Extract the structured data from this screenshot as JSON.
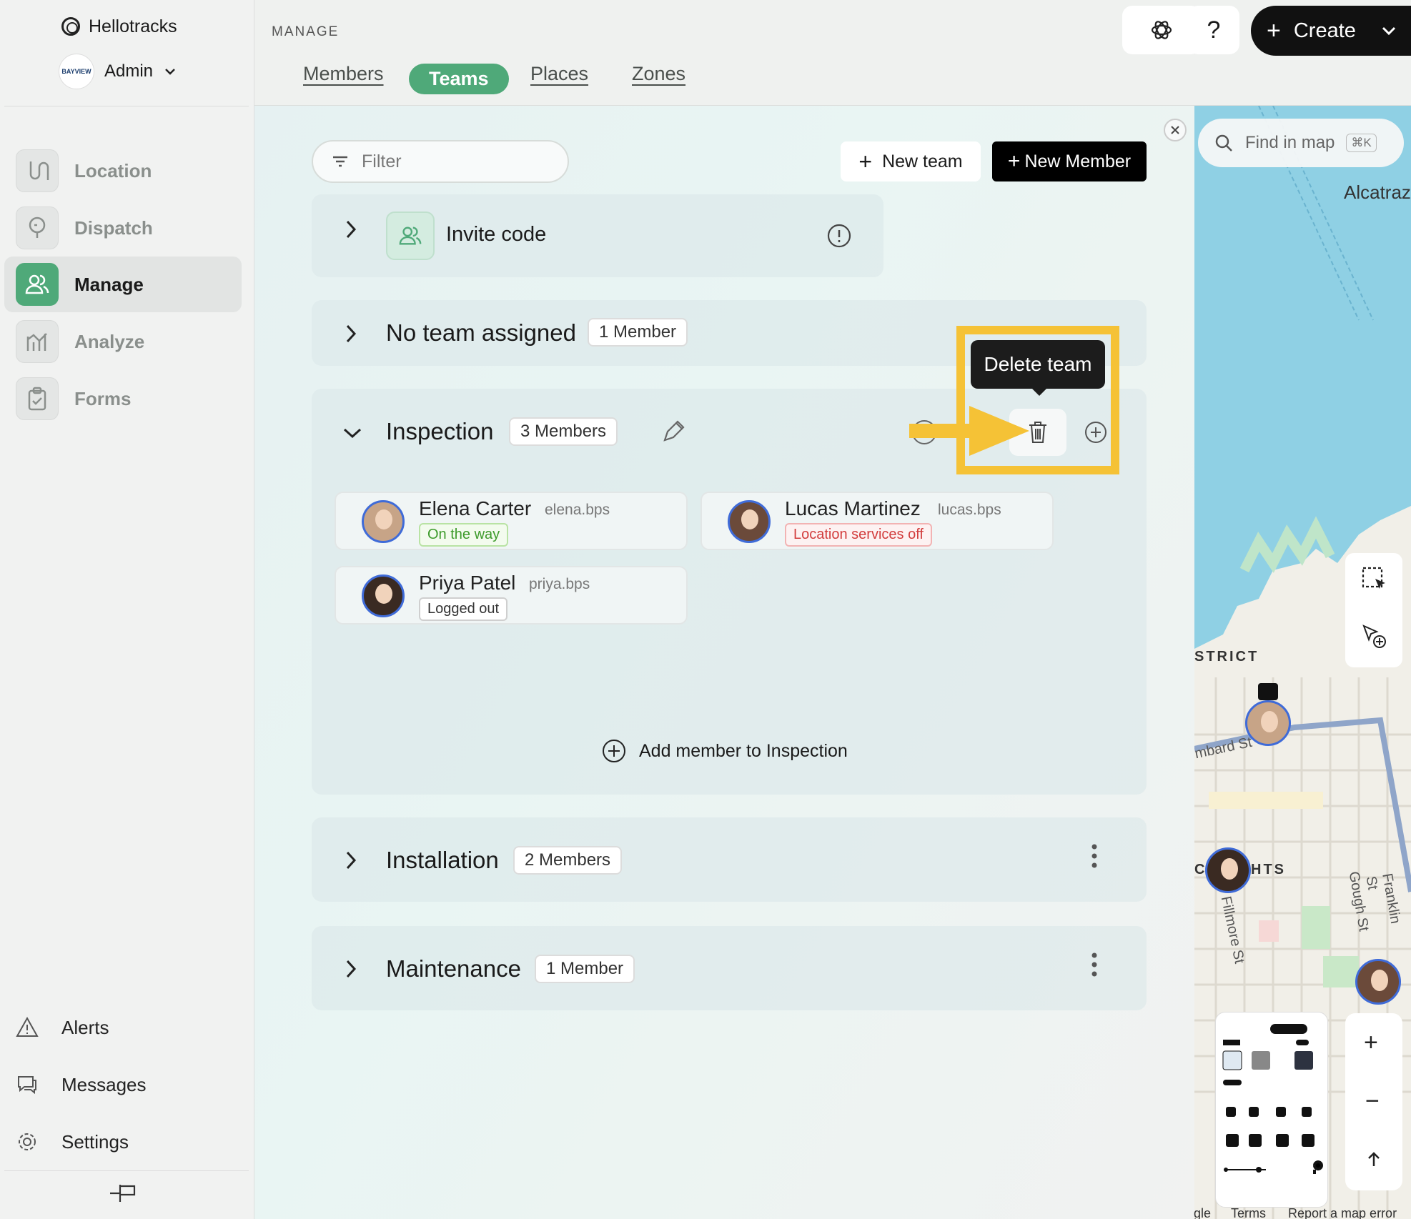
{
  "sidebar": {
    "brand": "Hellotracks",
    "account": {
      "name": "Admin",
      "avatar_text": "BAYVIEW"
    },
    "nav": [
      {
        "label": "Location",
        "icon": "route-icon"
      },
      {
        "label": "Dispatch",
        "icon": "dispatch-icon"
      },
      {
        "label": "Manage",
        "icon": "users-icon",
        "active": true
      },
      {
        "label": "Analyze",
        "icon": "chart-icon"
      },
      {
        "label": "Forms",
        "icon": "clipboard-icon"
      }
    ],
    "bottom": [
      {
        "label": "Alerts",
        "icon": "warning-icon"
      },
      {
        "label": "Messages",
        "icon": "chat-icon"
      },
      {
        "label": "Settings",
        "icon": "gear-icon"
      }
    ],
    "collapse_icon": "pin-collapse-icon"
  },
  "header": {
    "section_label": "MANAGE",
    "tabs": [
      "Members",
      "Teams",
      "Places",
      "Zones"
    ],
    "active_tab": "Teams",
    "help_label": "?",
    "create_label": "Create"
  },
  "toolbar": {
    "filter_placeholder": "Filter",
    "new_team_label": "New team",
    "new_member_label": "New Member"
  },
  "invite": {
    "label": "Invite code"
  },
  "teams": [
    {
      "name": "No team assigned",
      "count": "1 Member"
    },
    {
      "name": "Inspection",
      "count": "3 Members",
      "expanded": true,
      "members": [
        {
          "name": "Elena Carter",
          "username": "elena.bps",
          "status": "On the way",
          "status_color": "#3c9a2a"
        },
        {
          "name": "Lucas Martinez",
          "username": "lucas.bps",
          "status": "Location services off",
          "status_color": "#d23c3c"
        },
        {
          "name": "Priya Patel",
          "username": "priya.bps",
          "status": "Logged out",
          "status_color": "#333333"
        }
      ],
      "add_member_label": "Add member to Inspection"
    },
    {
      "name": "Installation",
      "count": "2 Members"
    },
    {
      "name": "Maintenance",
      "count": "1 Member"
    }
  ],
  "tooltip": {
    "label": "Delete team"
  },
  "map": {
    "search_placeholder": "Find in map",
    "shortcut": "⌘K",
    "labels": [
      "Alcatraz",
      "STRICT",
      "mbard St",
      "C",
      "HTS",
      "Fillmore St",
      "Gough St",
      "Franklin St"
    ],
    "footer": [
      "gle",
      "Terms",
      "Report a map error"
    ]
  },
  "colors": {
    "accent": "#4fa979",
    "highlight": "#f5c236",
    "avatar_ring": "#3f6bd8"
  }
}
